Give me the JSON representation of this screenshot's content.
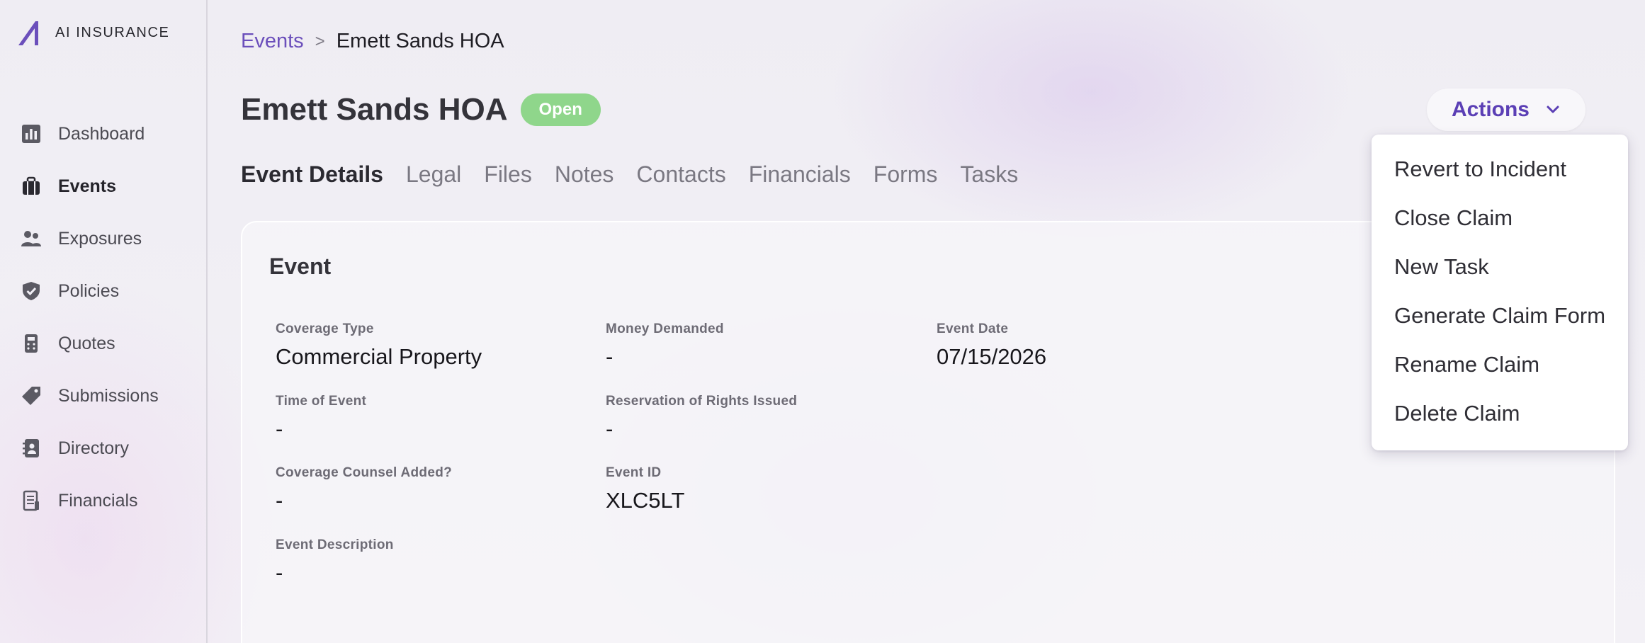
{
  "brand": {
    "name": "AI INSURANCE",
    "accent": "#6b4fbb"
  },
  "sidebar": {
    "items": [
      {
        "label": "Dashboard",
        "icon": "bar-chart-icon",
        "active": false
      },
      {
        "label": "Events",
        "icon": "briefcase-icon",
        "active": true
      },
      {
        "label": "Exposures",
        "icon": "users-icon",
        "active": false
      },
      {
        "label": "Policies",
        "icon": "shield-check-icon",
        "active": false
      },
      {
        "label": "Quotes",
        "icon": "calculator-icon",
        "active": false
      },
      {
        "label": "Submissions",
        "icon": "tag-icon",
        "active": false
      },
      {
        "label": "Directory",
        "icon": "contact-book-icon",
        "active": false
      },
      {
        "label": "Financials",
        "icon": "receipt-icon",
        "active": false
      }
    ]
  },
  "breadcrumb": {
    "parent": "Events",
    "separator": ">",
    "current": "Emett Sands HOA"
  },
  "header": {
    "title": "Emett Sands HOA",
    "status": "Open",
    "status_color": "#8fd68b",
    "actions_label": "Actions"
  },
  "tabs": [
    {
      "label": "Event Details",
      "active": true
    },
    {
      "label": "Legal",
      "active": false
    },
    {
      "label": "Files",
      "active": false
    },
    {
      "label": "Notes",
      "active": false
    },
    {
      "label": "Contacts",
      "active": false
    },
    {
      "label": "Financials",
      "active": false
    },
    {
      "label": "Forms",
      "active": false
    },
    {
      "label": "Tasks",
      "active": false
    }
  ],
  "card": {
    "title": "Event",
    "fields": {
      "coverage_type": {
        "label": "Coverage Type",
        "value": "Commercial Property"
      },
      "money_demanded": {
        "label": "Money Demanded",
        "value": "-"
      },
      "event_date": {
        "label": "Event Date",
        "value": "07/15/2026"
      },
      "time_of_event": {
        "label": "Time of Event",
        "value": "-"
      },
      "reservation": {
        "label": "Reservation of Rights Issued",
        "value": "-"
      },
      "coverage_counsel": {
        "label": "Coverage Counsel Added?",
        "value": "-"
      },
      "event_id": {
        "label": "Event ID",
        "value": "XLC5LT"
      },
      "event_description": {
        "label": "Event Description",
        "value": "-"
      }
    }
  },
  "actions_menu": {
    "items": [
      "Revert to Incident",
      "Close Claim",
      "New Task",
      "Generate Claim Form",
      "Rename Claim",
      "Delete Claim"
    ]
  }
}
